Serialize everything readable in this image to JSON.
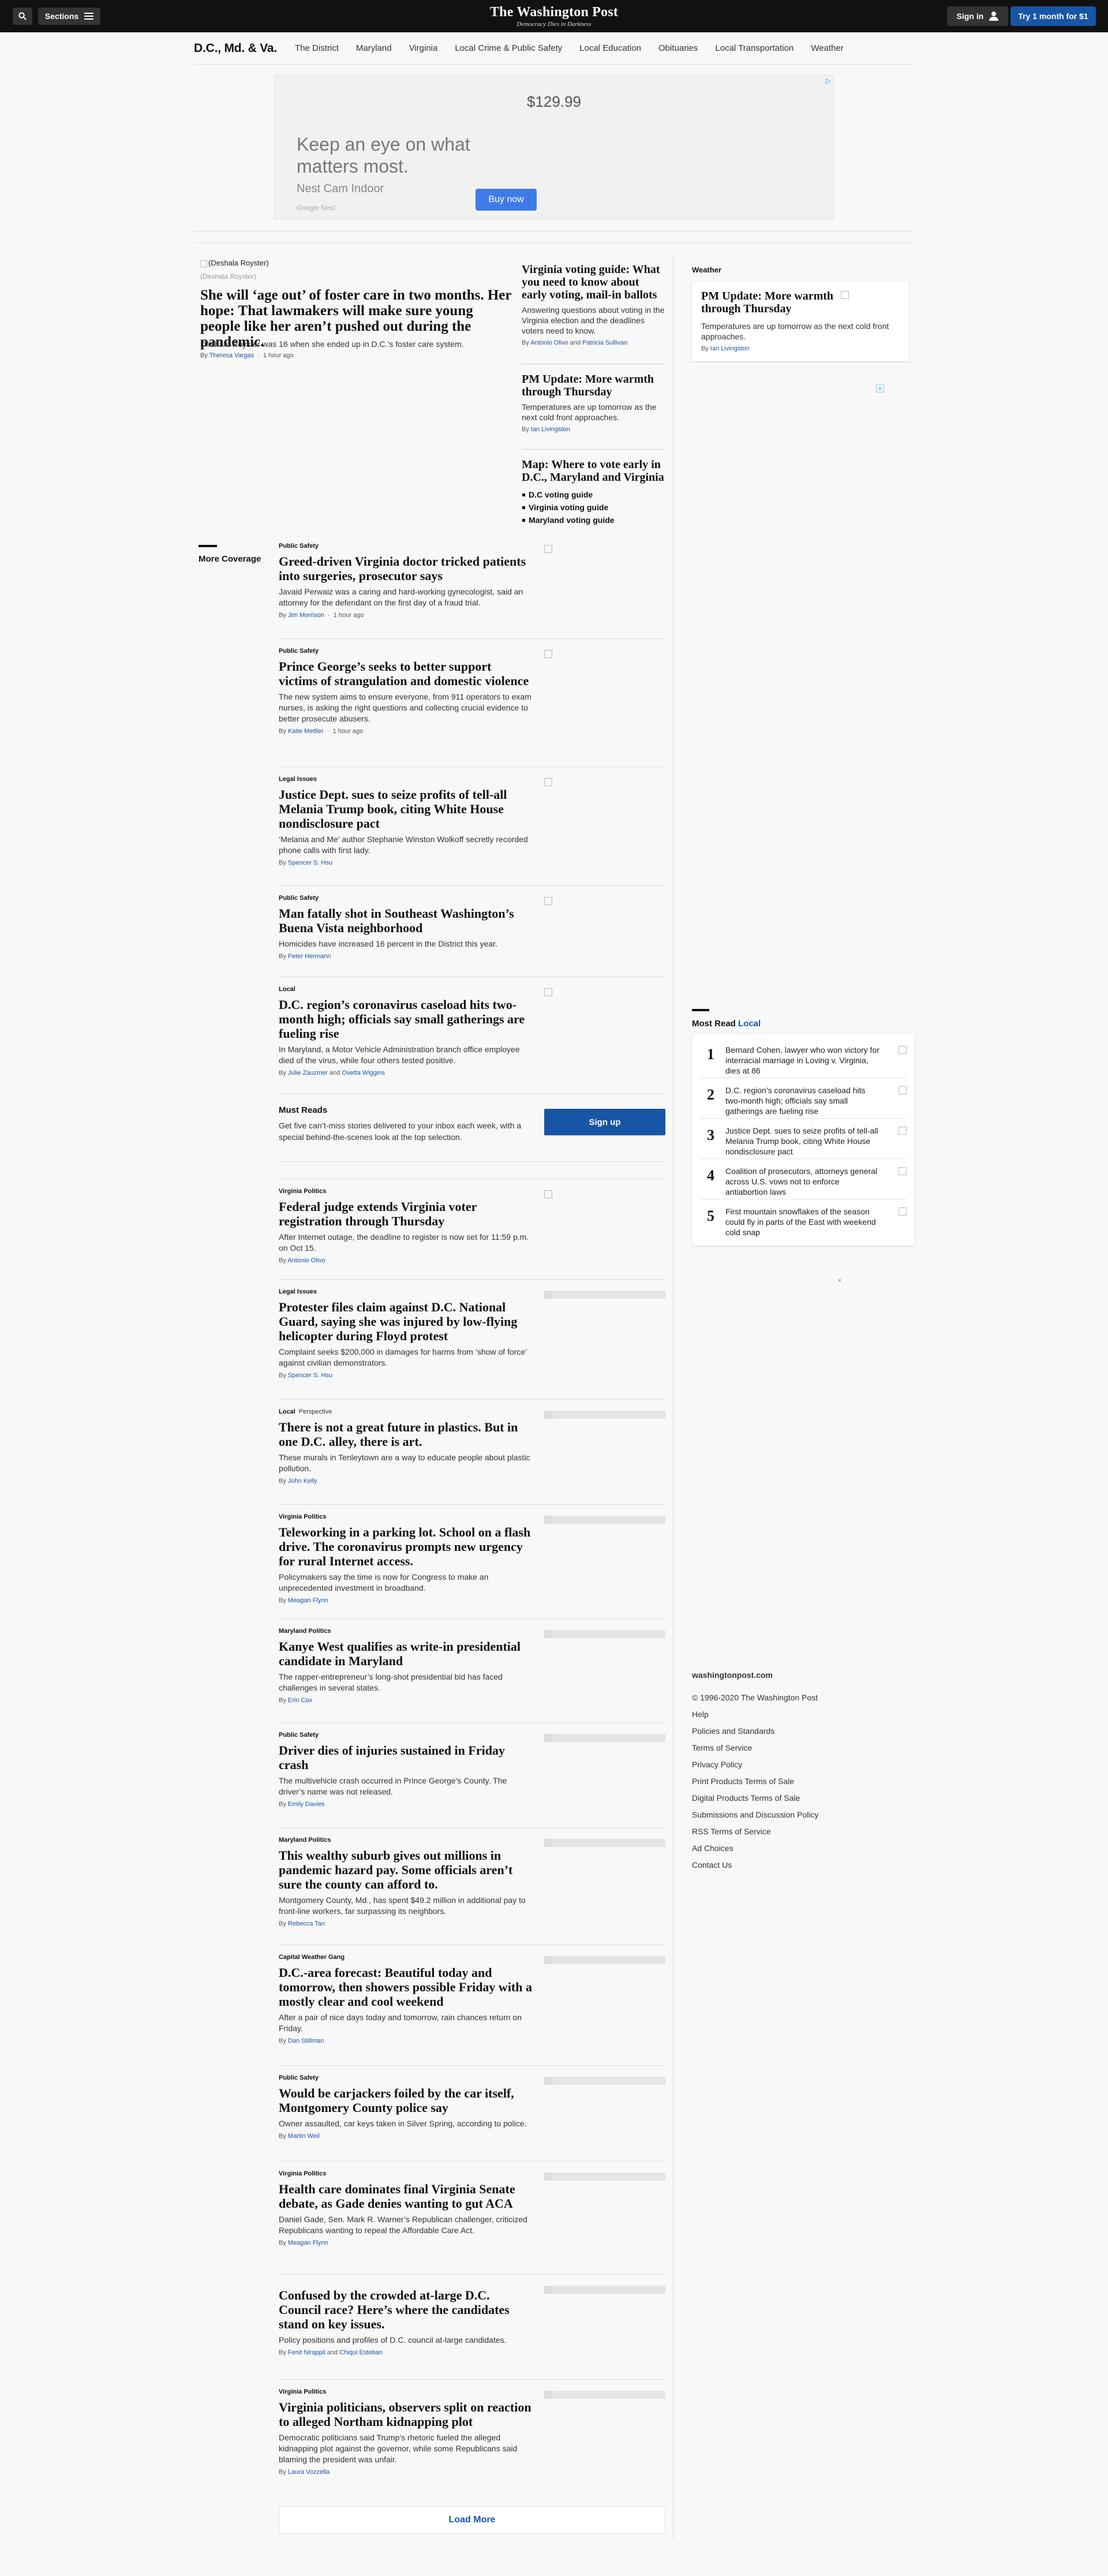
{
  "header": {
    "sections_label": "Sections",
    "logo": "The Washington Post",
    "tagline": "Democracy Dies in Darkness",
    "signin_label": "Sign in",
    "subscribe_label": "Try 1 month for $1"
  },
  "section_nav": {
    "title": "D.C., Md. & Va.",
    "links": [
      "The District",
      "Maryland",
      "Virginia",
      "Local Crime & Public Safety",
      "Local Education",
      "Obituaries",
      "Local Transportation",
      "Weather"
    ]
  },
  "ad": {
    "price": "$129.99",
    "headline": "Keep an eye on what matters most.",
    "product": "Nest Cam Indoor",
    "brand": "Google Nest",
    "button": "Buy now"
  },
  "top_story": {
    "image_alt": "(Deshala Royster)",
    "caption": "(Deshala Royster)",
    "headline": "She will ‘age out’ of foster care in two months. Her hope: That lawmakers will make sure young people like her aren’t pushed out during the pandemic.",
    "blurb": "Deshala Royster was 16 when she ended up in D.C.’s foster care system.",
    "by": "By",
    "author": "Theresa Vargas",
    "time": "1 hour ago"
  },
  "mid_stories": [
    {
      "headline": "Virginia voting guide: What you need to know about early voting, mail-in ballots",
      "blurb": "Answering questions about voting in the Virginia election and the deadlines voters need to know.",
      "by": "By",
      "author1": "Antonio Olivo",
      "and": "and",
      "author2": "Patricia Sullivan"
    },
    {
      "headline": "PM Update: More warmth through Thursday",
      "blurb": "Temperatures are up tomorrow as the next cold front approaches.",
      "by": "By",
      "author": "Ian Livingston"
    },
    {
      "headline": "Map: Where to vote early in D.C., Maryland and Virginia",
      "links": [
        "D.C voting guide",
        "Virginia voting guide",
        "Maryland voting guide"
      ]
    }
  ],
  "sidebar": {
    "weather_label": "Weather",
    "weather_headline": "PM Update: More warmth through Thursday",
    "weather_blurb": "Temperatures are up tomorrow as the next cold front approaches.",
    "weather_by": "By",
    "weather_author": "Ian Livingston",
    "most_read_label": "Most Read",
    "most_read_section": "Local",
    "most_read": [
      {
        "num": "1",
        "text": "Bernard Cohen, lawyer who won victory for interracial marriage in Loving v. Virginia, dies at 86"
      },
      {
        "num": "2",
        "text": "D.C. region’s coronavirus caseload hits two-month high; officials say small gatherings are fueling rise"
      },
      {
        "num": "3",
        "text": "Justice Dept. sues to seize profits of tell-all Melania Trump book, citing White House nondisclosure pact"
      },
      {
        "num": "4",
        "text": "Coalition of prosecutors, attorneys general across U.S. vows not to enforce antiabortion laws"
      },
      {
        "num": "5",
        "text": "First mountain snowflakes of the season could fly in parts of the East with weekend cold snap"
      }
    ],
    "footer_site": "washingtonpost.com",
    "footer_links": [
      "© 1996-2020 The Washington Post",
      "Help",
      "Policies and Standards",
      "Terms of Service",
      "Privacy Policy",
      "Print Products Terms of Sale",
      "Digital Products Terms of Sale",
      "Submissions and Discussion Policy",
      "RSS Terms of Service",
      "Ad Choices",
      "Contact Us"
    ]
  },
  "more_coverage_label": "More Coverage",
  "feed": [
    {
      "kicker": "Public Safety",
      "headline": "Greed-driven Virginia doctor tricked patients into surgeries, prosecutor says",
      "blurb": "Javaid Perwaiz was a caring and hard-working gynecologist, said an attorney for the defendant on the first day of a fraud trial.",
      "by": "By",
      "author": "Jim Morrison",
      "time": "1 hour ago"
    },
    {
      "kicker": "Public Safety",
      "headline": "Prince George’s seeks to better support victims of strangulation and domestic violence",
      "blurb": "The new system aims to ensure everyone, from 911 operators to exam nurses, is asking the right questions and collecting crucial evidence to better prosecute abusers.",
      "by": "By",
      "author": "Katie Mettler",
      "time": "1 hour ago"
    },
    {
      "kicker": "Legal Issues",
      "headline": "Justice Dept. sues to seize profits of tell-all Melania Trump book, citing White House nondisclosure pact",
      "blurb": "‘Melania and Me’ author Stephanie Winston Wolkoff secretly recorded phone calls with first lady.",
      "by": "By",
      "author": "Spencer S. Hsu"
    },
    {
      "kicker": "Public Safety",
      "headline": "Man fatally shot in Southeast Washington’s Buena Vista neighborhood",
      "blurb": "Homicides have increased 16 percent in the District this year.",
      "by": "By",
      "author": "Peter Hermann"
    },
    {
      "kicker": "Local",
      "headline": "D.C. region’s coronavirus caseload hits two-month high; officials say small gatherings are fueling rise",
      "blurb": "In Maryland, a Motor Vehicle Administration branch office employee died of the virus, while four others tested positive.",
      "by": "By",
      "author": "Julie Zauzmer",
      "and": "and",
      "author2": "Ovetta Wiggins"
    },
    {
      "kicker": "Virginia Politics",
      "headline": "Federal judge extends Virginia voter registration through Thursday",
      "blurb": "After Internet outage, the deadline to register is now set for 11:59 p.m. on Oct 15.",
      "by": "By",
      "author": "Antonio Olivo"
    },
    {
      "kicker": "Legal Issues",
      "headline": "Protester files claim against D.C. National Guard, saying she was injured by low-flying helicopter during Floyd protest",
      "blurb": "Complaint seeks $200,000 in damages for harms from ‘show of force’ against civilian demonstrators.",
      "by": "By",
      "author": "Spencer S. Hsu"
    },
    {
      "kicker": "Local",
      "kicker2": "Perspective",
      "headline": "There is not a great future in plastics. But in one D.C. alley, there is art.",
      "blurb": "These murals in Tenleytown are a way to educate people about plastic pollution.",
      "by": "By",
      "author": "John Kelly"
    },
    {
      "kicker": "Virginia Politics",
      "headline": "Teleworking in a parking lot. School on a flash drive. The coronavirus prompts new urgency for rural Internet access.",
      "blurb": "Policymakers say the time is now for Congress to make an unprecedented investment in broadband.",
      "by": "By",
      "author": "Meagan Flynn"
    },
    {
      "kicker": "Maryland Politics",
      "headline": "Kanye West qualifies as write-in presidential candidate in Maryland",
      "blurb": "The rapper-entrepreneur’s long-shot presidential bid has faced challenges in several states.",
      "by": "By",
      "author": "Erin Cox"
    },
    {
      "kicker": "Public Safety",
      "headline": "Driver dies of injuries sustained in Friday crash",
      "blurb": "The multivehicle crash occurred in Prince George’s County. The driver’s name was not released.",
      "by": "By",
      "author": "Emily Davies"
    },
    {
      "kicker": "Maryland Politics",
      "headline": "This wealthy suburb gives out millions in pandemic hazard pay. Some officials aren’t sure the county can afford to.",
      "blurb": "Montgomery County, Md., has spent $49.2 million in additional pay to front-line workers, far surpassing its neighbors.",
      "by": "By",
      "author": "Rebecca Tan"
    },
    {
      "kicker": "Capital Weather Gang",
      "headline": "D.C.-area forecast: Beautiful today and tomorrow, then showers possible Friday with a mostly clear and cool weekend",
      "blurb": "After a pair of nice days today and tomorrow, rain chances return on Friday.",
      "by": "By",
      "author": "Dan Stillman"
    },
    {
      "kicker": "Public Safety",
      "headline": "Would be carjackers foiled by the car itself, Montgomery County police say",
      "blurb": "Owner assaulted, car keys taken in Silver Spring, according to police.",
      "by": "By",
      "author": "Martin Weil"
    },
    {
      "kicker": "Virginia Politics",
      "headline": "Health care dominates final Virginia Senate debate, as Gade denies wanting to gut ACA",
      "blurb": "Daniel Gade, Sen. Mark R. Warner’s Republican challenger, criticized Republicans wanting to repeal the Affordable Care Act.",
      "by": "By",
      "author": "Meagan Flynn"
    },
    {
      "kicker": "",
      "headline": "Confused by the crowded at-large D.C. Council race? Here’s where the candidates stand on key issues.",
      "blurb": "Policy positions and profiles of D.C. council at-large candidates.",
      "by": "By",
      "author": "Fenit Nirappil",
      "and": "and",
      "author2": "Chiqui Esteban"
    },
    {
      "kicker": "Virginia Politics",
      "headline": "Virginia politicians, observers split on reaction to alleged Northam kidnapping plot",
      "blurb": "Democratic politicians said Trump’s rhetoric fueled the alleged kidnapping plot against the governor, while some Republicans said blaming the president was unfair.",
      "by": "By",
      "author": "Laura Vozzella"
    }
  ],
  "must_reads": {
    "title": "Must Reads",
    "blurb": "Get five can’t-miss stories delivered to your inbox each week, with a special behind-the-scenes look at the top selection.",
    "button": "Sign up"
  },
  "load_more": "Load More"
}
